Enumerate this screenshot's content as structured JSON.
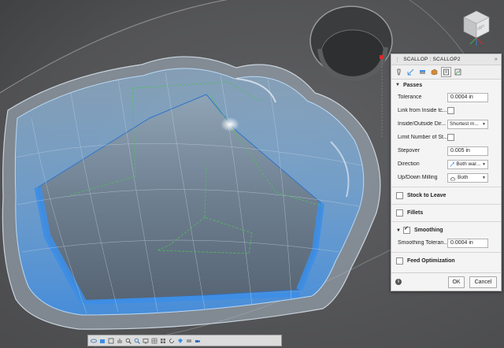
{
  "panel": {
    "title": "SCALLOP : SCALLOP2",
    "sections": {
      "passes": "Passes"
    },
    "fields": {
      "tolerance": {
        "label": "Tolerance",
        "value": "0.0004 in"
      },
      "link_inside": {
        "label": "Link from Inside tc..."
      },
      "inside_outside": {
        "label": "Inside/Outside Dir...",
        "value": "Shortest m..."
      },
      "limit_number": {
        "label": "Limit Number of St..."
      },
      "stepover": {
        "label": "Stepover",
        "value": "0.005 in"
      },
      "direction": {
        "label": "Direction",
        "value": "Both war..."
      },
      "updown": {
        "label": "Up/Down Milling",
        "value": "Both"
      }
    },
    "groups": {
      "stock_to_leave": "Stock to Leave",
      "fillets": "Fillets",
      "smoothing": "Smoothing",
      "feed_optimization": "Feed Optimization"
    },
    "smoothing_tolerance": {
      "label": "Smoothing Toleran...",
      "value": "0.0004 in"
    },
    "buttons": {
      "ok": "OK",
      "cancel": "Cancel"
    }
  },
  "viewcube": {
    "face_label": "LEFT"
  },
  "toolbar": {
    "icons": [
      "orbit-icon",
      "pan-hand-icon",
      "look-at-icon",
      "hand-icon",
      "zoom-icon",
      "zoom-window-icon",
      "display-settings-icon",
      "grid-icon",
      "viewports-icon",
      "rotate-icon",
      "visual-style-icon",
      "effects-icon",
      "camera-icon"
    ]
  },
  "colors": {
    "accent": "#3d8ee6",
    "toolpath": "#4a9cf0",
    "panel_bg": "#f4f4f4",
    "background": "#4a4b4d"
  }
}
